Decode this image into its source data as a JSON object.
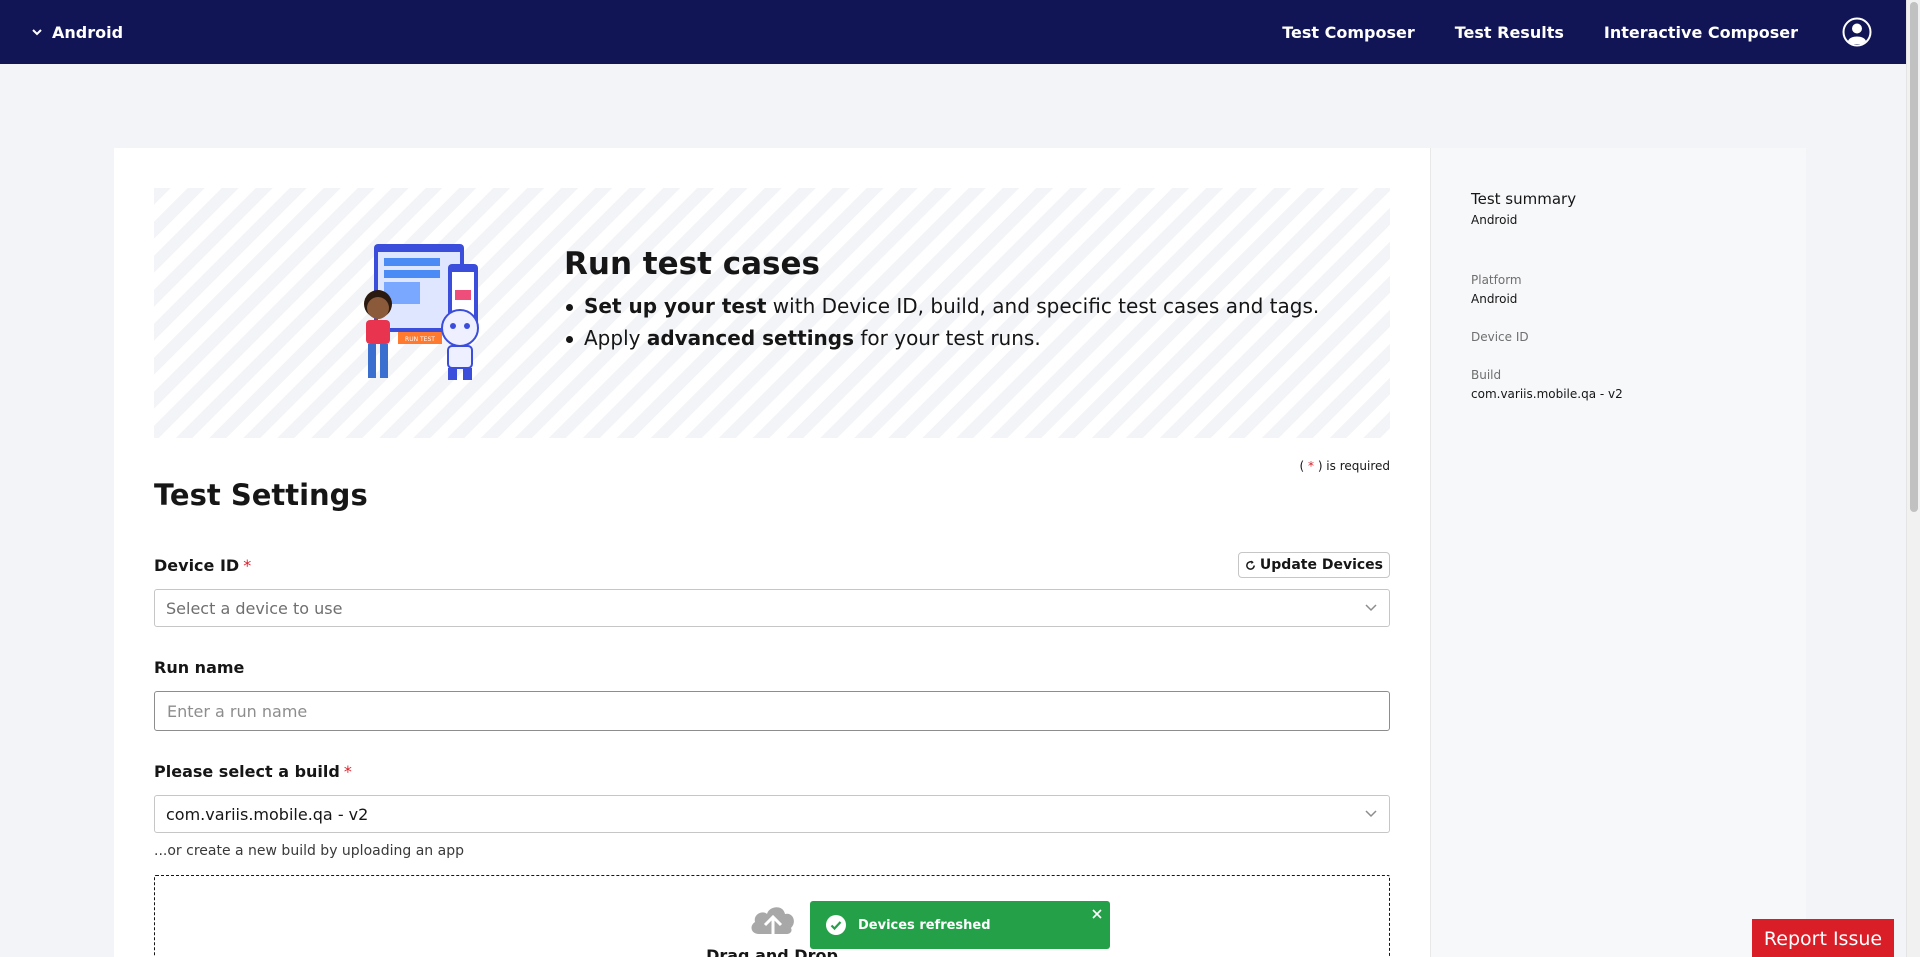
{
  "header": {
    "project": "Android",
    "nav": [
      "Test Composer",
      "Test Results",
      "Interactive Composer"
    ]
  },
  "banner": {
    "title": "Run test cases",
    "line1_bold": "Set up your test",
    "line1_rest": " with Device ID, build, and specific test cases and tags.",
    "line2_start": "Apply ",
    "line2_bold": "advanced settings",
    "line2_rest": " for your test runs.",
    "illustration_badge": "RUN TEST"
  },
  "form": {
    "required_note_open": "( ",
    "required_star": "*",
    "required_note_close": " ) is required",
    "section_title": "Test Settings",
    "device_label": "Device ID",
    "update_devices": "Update Devices",
    "device_placeholder": "Select a device to use",
    "run_name_label": "Run name",
    "run_name_placeholder": "Enter a run name",
    "build_label": "Please select a build",
    "build_value": "com.variis.mobile.qa - v2",
    "build_helper": "...or create a new build by uploading an app",
    "drop_text": "Drag and Drop"
  },
  "summary": {
    "title": "Test summary",
    "subtitle": "Android",
    "platform_label": "Platform",
    "platform_value": "Android",
    "device_label": "Device ID",
    "build_label": "Build",
    "build_value": "com.variis.mobile.qa - v2"
  },
  "toast": {
    "message": "Devices refreshed"
  },
  "report_button": "Report Issue",
  "colors": {
    "nav_bg": "#111555",
    "required": "#da1e28",
    "toast_bg": "#24a148",
    "report": "#da1e28"
  }
}
